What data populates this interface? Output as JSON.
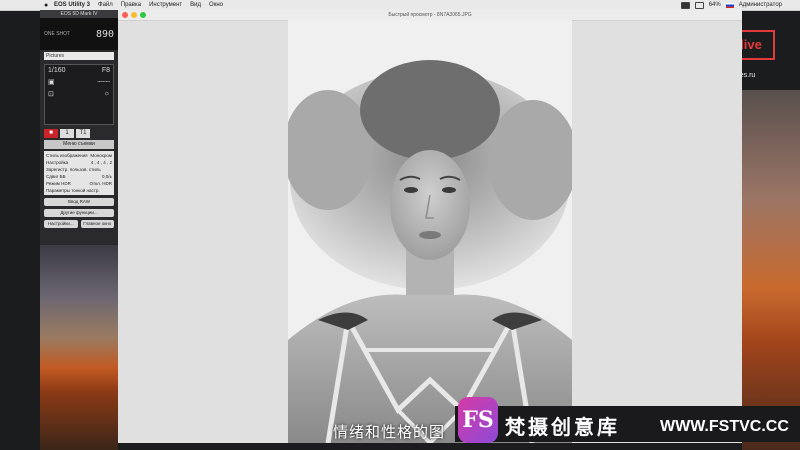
{
  "menubar": {
    "app_name": "EOS Utility 3",
    "items": [
      "Файл",
      "Правка",
      "Инструмент",
      "Вид",
      "Окно"
    ],
    "right_text": "64%",
    "user": "Администратор"
  },
  "eos": {
    "title": "EOS 5D Mark IV",
    "model_label": "ONE SHOT",
    "shots": "890",
    "style_select": "Pictures",
    "shutter": "1/160",
    "aperture": "F8",
    "tabs": [
      "■",
      "1",
      "T1"
    ],
    "menu_title": "Меню съемки",
    "settings": [
      {
        "name": "Стиль изображения",
        "value": "Монохром"
      },
      {
        "name": "Настройка",
        "value": "4 , 4 , 4 , 2"
      },
      {
        "name": "Зарегистр. пользов. стиль",
        "value": ""
      },
      {
        "name": "Сдвиг ББ",
        "value": "0,0/±"
      },
      {
        "name": "Режим HDR",
        "value": "Откл. HDR"
      },
      {
        "name": "Параметры тонкой настр.",
        "value": ""
      }
    ],
    "buttons": [
      "Ввод RAW",
      "Другие функции..."
    ],
    "bottom_buttons": [
      "Настройки...",
      "Главное окно"
    ]
  },
  "preview": {
    "title": "Быстрый просмотр - 8N7A3065.JPG"
  },
  "overlay": {
    "subtitle": "情绪和性格的图",
    "brand_logo": "FS",
    "brand_name": "梵摄创意库",
    "brand_url": "WWW.FSTVC.CC",
    "live_logo": "live",
    "site": "ly.ceries.ru"
  },
  "colors": {
    "accent": "#c8242a",
    "brand_purple": "#8d4ad8"
  }
}
